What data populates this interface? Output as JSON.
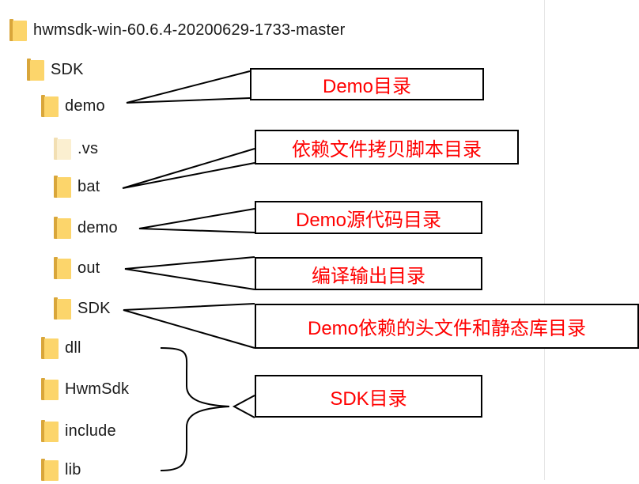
{
  "tree": {
    "root": "hwmsdk-win-60.6.4-20200629-1733-master",
    "sdk": "SDK",
    "demo": "demo",
    "vs": ".vs",
    "bat": "bat",
    "demo_sub": "demo",
    "out": "out",
    "sdk_sub": "SDK",
    "dll": "dll",
    "hwmsdk": "HwmSdk",
    "include": "include",
    "lib": "lib"
  },
  "callouts": {
    "demo_dir": "Demo目录",
    "bat_dir": "依赖文件拷贝脚本目录",
    "src_dir": "Demo源代码目录",
    "out_dir": "编译输出目录",
    "deps_dir": "Demo依赖的头文件和静态库目录",
    "sdk_dir": "SDK目录"
  },
  "colors": {
    "callout_text": "#ff0000",
    "folder": "#fcd56b",
    "folder_tab": "#d9a63a"
  }
}
